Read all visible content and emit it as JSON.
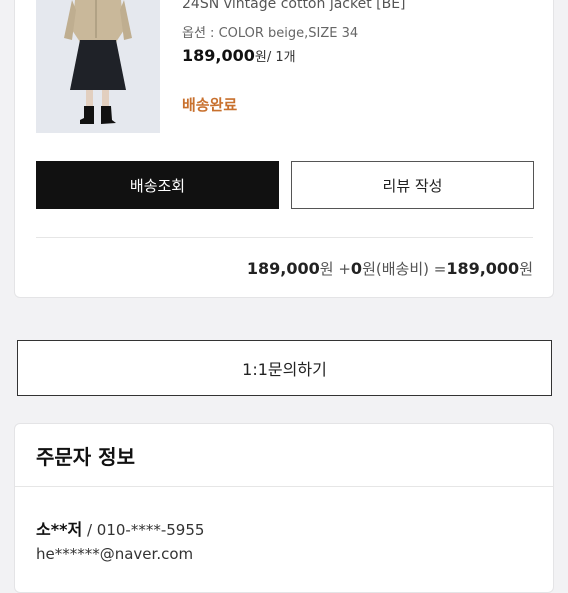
{
  "order": {
    "product_name": "24SN vintage cotton jacket [BE]",
    "option": "옵션 : COLOR beige,SIZE 34",
    "price": "189,000",
    "price_unit": "원/ 1개",
    "status": "배송완료",
    "buttons": {
      "track": "배송조회",
      "review": "리뷰 작성"
    },
    "summary": {
      "product_total": "189,000",
      "won1": "원",
      "plus": " +",
      "shipping": "0",
      "shipping_label": "원(배송비) =",
      "total": "189,000",
      "won2": "원"
    }
  },
  "inquiry_button": "1:1문의하기",
  "orderer": {
    "title": "주문자 정보",
    "name": "소**저",
    "separator": " / ",
    "phone": "010-****-5955",
    "email": "he******@naver.com"
  },
  "colors": {
    "status": "#c8702d",
    "primary_button": "#111111"
  }
}
